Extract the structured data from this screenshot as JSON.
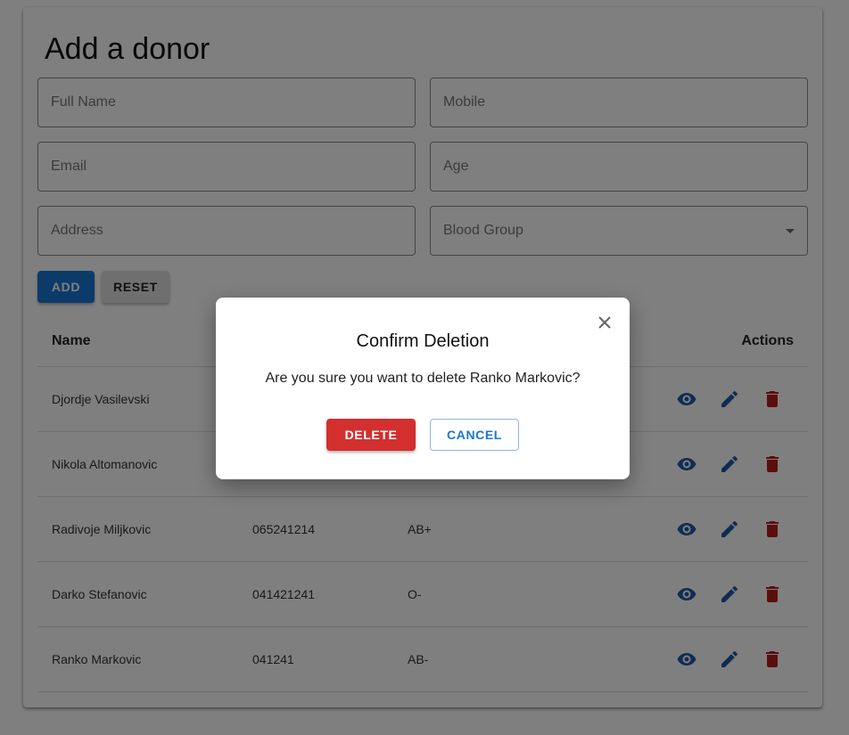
{
  "form": {
    "title": "Add a donor",
    "full_name_placeholder": "Full Name",
    "mobile_placeholder": "Mobile",
    "email_placeholder": "Email",
    "age_placeholder": "Age",
    "address_placeholder": "Address",
    "blood_group_label": "Blood Group",
    "add_label": "ADD",
    "reset_label": "RESET"
  },
  "table": {
    "headers": {
      "name": "Name",
      "actions": "Actions"
    },
    "rows": [
      {
        "name": "Djordje Vasilevski",
        "mobile": "",
        "blood": ""
      },
      {
        "name": "Nikola Altomanovic",
        "mobile": "",
        "blood": ""
      },
      {
        "name": "Radivoje Miljkovic",
        "mobile": "065241214",
        "blood": "AB+"
      },
      {
        "name": "Darko Stefanovic",
        "mobile": "041421241",
        "blood": "O-"
      },
      {
        "name": "Ranko Markovic",
        "mobile": "041241",
        "blood": "AB-"
      }
    ]
  },
  "dialog": {
    "title": "Confirm Deletion",
    "message": "Are you sure you want to delete Ranko Markovic?",
    "delete_label": "DELETE",
    "cancel_label": "CANCEL"
  },
  "colors": {
    "primary": "#1976d2",
    "danger": "#d32f2f",
    "view_icon": "#1e5aa8",
    "edit_icon": "#1e5aa8",
    "delete_icon": "#b71c1c"
  },
  "icons": {
    "view": "eye-icon",
    "edit": "pencil-icon",
    "delete": "trash-icon",
    "close": "close-icon",
    "dropdown": "caret-down-icon"
  }
}
